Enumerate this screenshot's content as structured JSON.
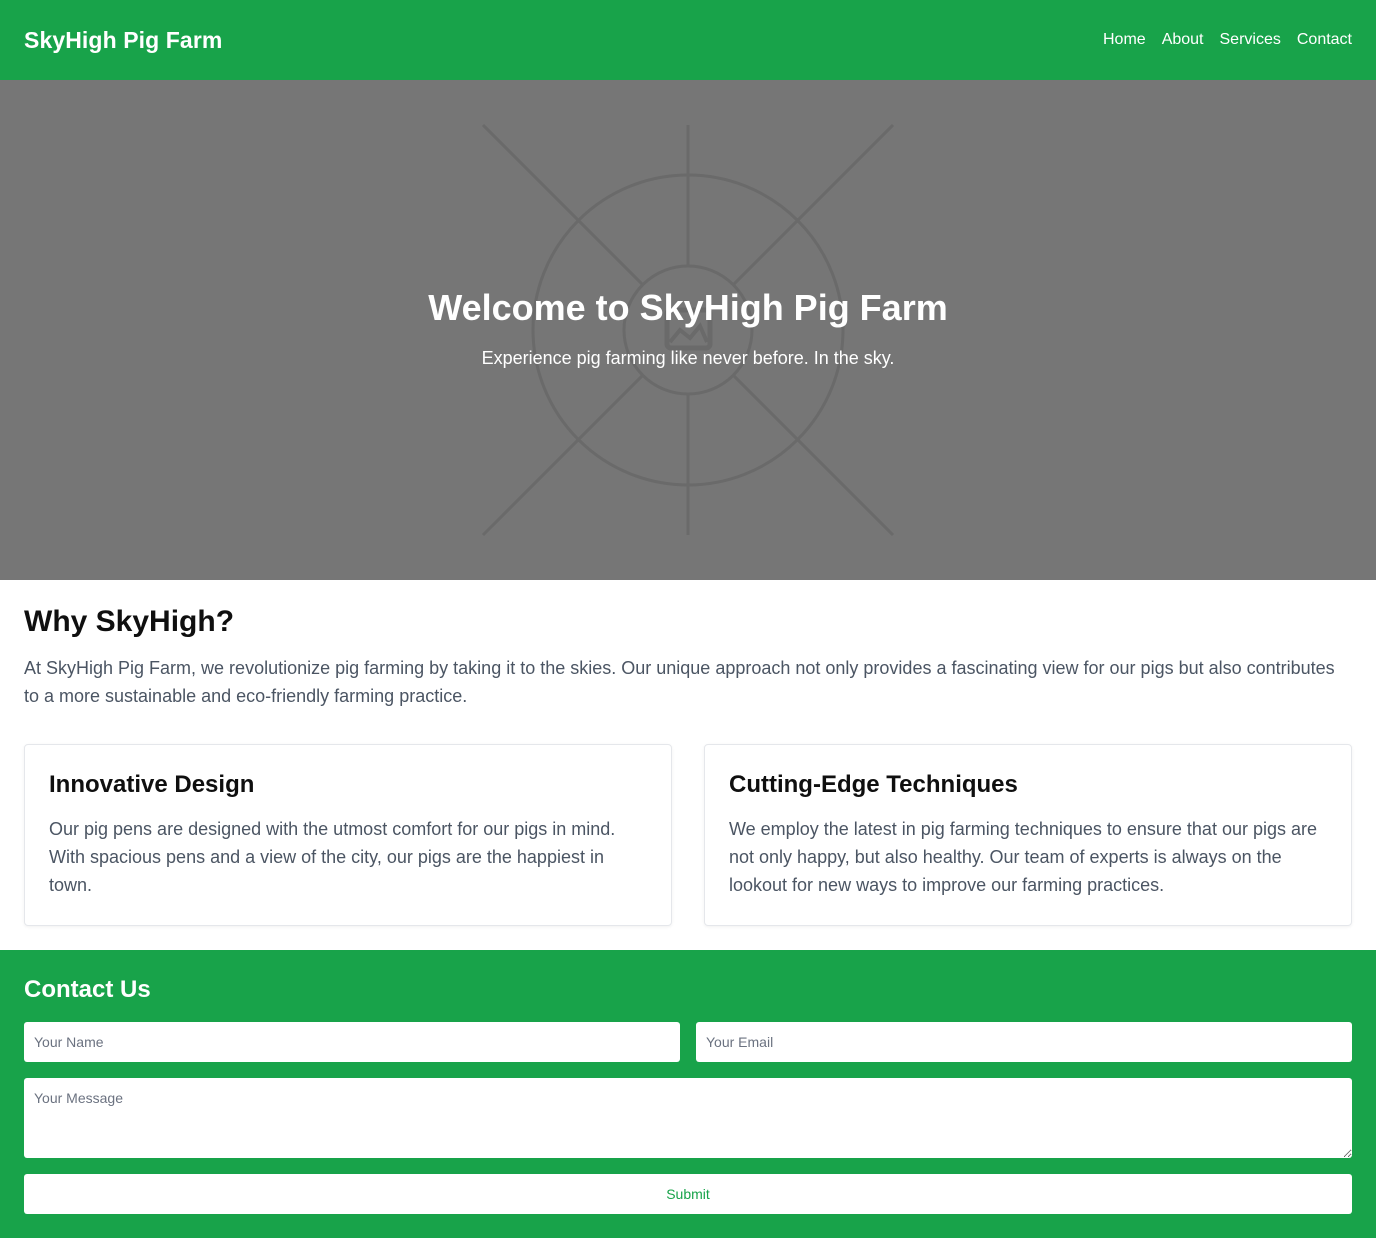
{
  "navbar": {
    "brand": "SkyHigh Pig Farm",
    "links": [
      "Home",
      "About",
      "Services",
      "Contact"
    ]
  },
  "hero": {
    "title": "Welcome to SkyHigh Pig Farm",
    "subtitle": "Experience pig farming like never before. In the sky.",
    "image_icon": "image-placeholder-icon"
  },
  "why": {
    "title": "Why SkyHigh?",
    "text": "At SkyHigh Pig Farm, we revolutionize pig farming by taking it to the skies. Our unique approach not only provides a fascinating view for our pigs but also contributes to a more sustainable and eco-friendly farming practice."
  },
  "cards": [
    {
      "title": "Innovative Design",
      "text": "Our pig pens are designed with the utmost comfort for our pigs in mind. With spacious pens and a view of the city, our pigs are the happiest in town."
    },
    {
      "title": "Cutting-Edge Techniques",
      "text": "We employ the latest in pig farming techniques to ensure that our pigs are not only happy, but also healthy. Our team of experts is always on the lookout for new ways to improve our farming practices."
    }
  ],
  "contact": {
    "title": "Contact Us",
    "name_placeholder": "Your Name",
    "email_placeholder": "Your Email",
    "message_placeholder": "Your Message",
    "submit_label": "Submit"
  },
  "colors": {
    "brand_green": "#18a34a",
    "hero_gray": "#767676",
    "body_text": "#4b5563"
  }
}
